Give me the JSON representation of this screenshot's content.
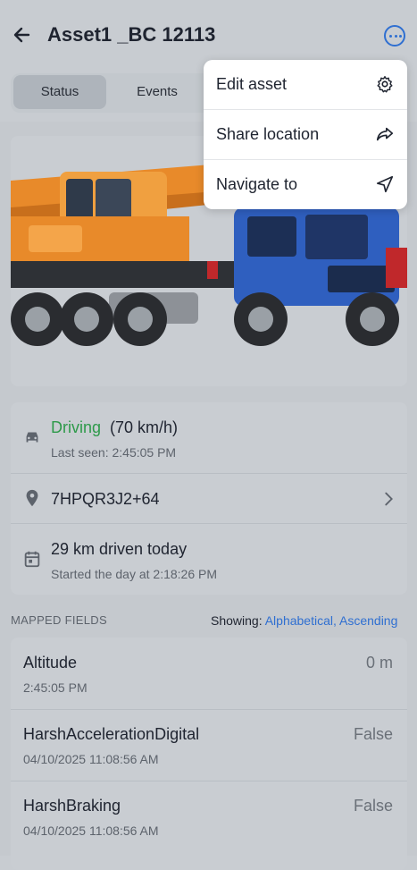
{
  "header": {
    "title": "Asset1 _BC 12113"
  },
  "tabs": [
    {
      "label": "Status"
    },
    {
      "label": "Events"
    }
  ],
  "status": {
    "driving_label": "Driving",
    "speed": "(70 km/h)",
    "last_seen": "Last seen: 2:45:05 PM",
    "location_code": "7HPQR3J2+64",
    "distance": "29 km driven today",
    "started": "Started the day at 2:18:26 PM"
  },
  "mapped_fields": {
    "section_label": "MAPPED FIELDS",
    "showing_label": "Showing:",
    "showing_value": "Alphabetical, Ascending",
    "items": [
      {
        "name": "Altitude",
        "value": "0 m",
        "time": "2:45:05 PM"
      },
      {
        "name": "HarshAccelerationDigital",
        "value": "False",
        "time": "04/10/2025 11:08:56 AM"
      },
      {
        "name": "HarshBraking",
        "value": "False",
        "time": "04/10/2025 11:08:56 AM"
      }
    ]
  },
  "menu": {
    "items": [
      {
        "label": "Edit asset",
        "icon": "gear-icon"
      },
      {
        "label": "Share location",
        "icon": "share-icon"
      },
      {
        "label": "Navigate to",
        "icon": "navigate-icon"
      }
    ]
  },
  "colors": {
    "accent": "#2f6fd1",
    "driving_green": "#2e9a4a",
    "truck_blue": "#2f5fbf",
    "crane_orange": "#e88a2a"
  }
}
